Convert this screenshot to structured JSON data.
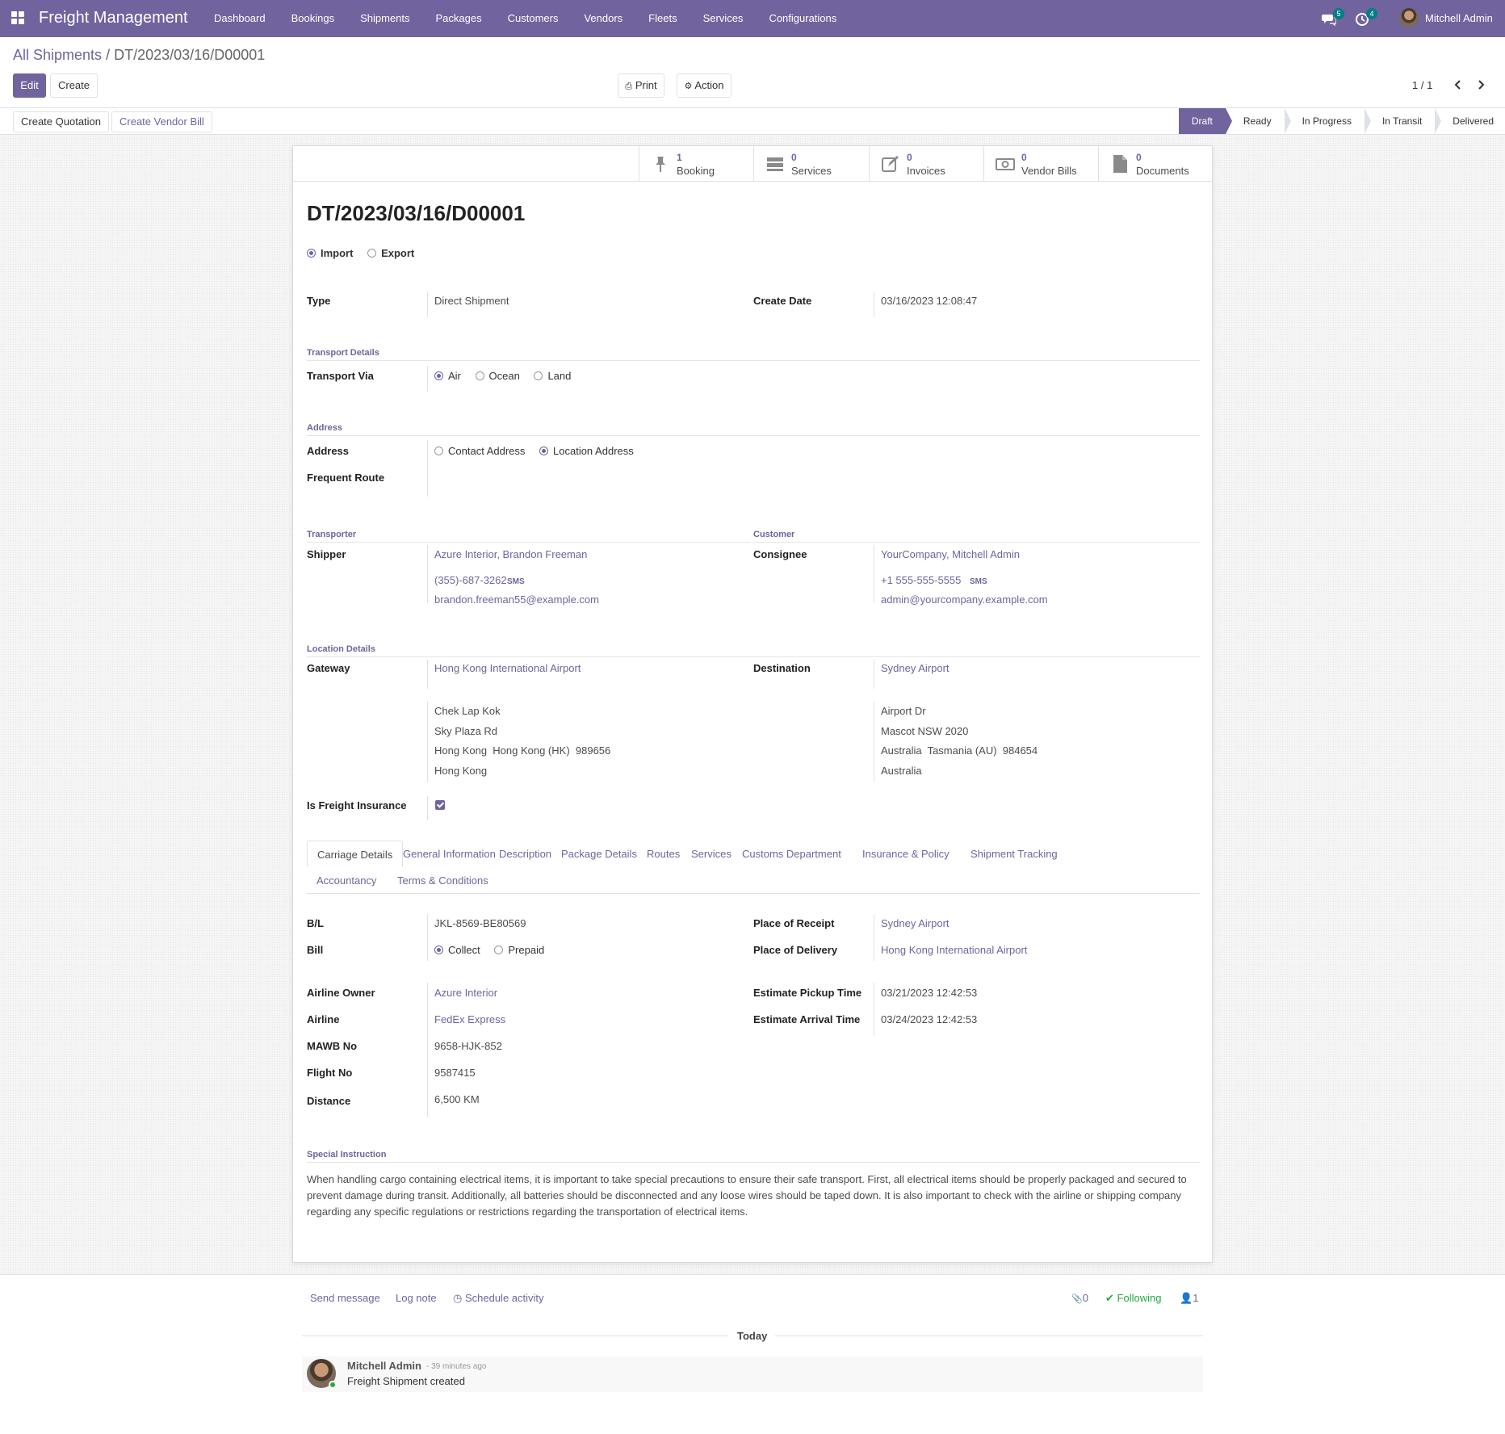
{
  "app": {
    "brand": "Freight Management",
    "user": "Mitchell Admin"
  },
  "navbar": {
    "menu": [
      "Dashboard",
      "Bookings",
      "Shipments",
      "Packages",
      "Customers",
      "Vendors",
      "Fleets",
      "Services",
      "Configurations"
    ],
    "messages_badge": "5",
    "activities_badge": "4",
    "icons": [
      "apps-grid-icon",
      "chat-icon",
      "activity-clock-icon"
    ]
  },
  "breadcrumb": {
    "parent": "All Shipments",
    "separator": "/",
    "current": "DT/2023/03/16/D00001"
  },
  "controls": {
    "edit": "Edit",
    "create": "Create",
    "print": "Print",
    "action": "Action",
    "pager": "1 / 1"
  },
  "statusbar": {
    "create_quotation": "Create Quotation",
    "create_vendor_bill": "Create Vendor Bill",
    "stages": [
      "Draft",
      "Ready",
      "In Progress",
      "In Transit",
      "Delivered"
    ],
    "active_stage": "Draft"
  },
  "smart_buttons": [
    {
      "count": "1",
      "label": "Booking",
      "icon": "pin-icon"
    },
    {
      "count": "0",
      "label": "Services",
      "icon": "server-icon"
    },
    {
      "count": "0",
      "label": "Invoices",
      "icon": "edit-icon"
    },
    {
      "count": "0",
      "label": "Vendor Bills",
      "icon": "money-icon"
    },
    {
      "count": "0",
      "label": "Documents",
      "icon": "file-icon"
    }
  ],
  "record": {
    "name": "DT/2023/03/16/D00001",
    "direction_options": [
      "Import",
      "Export"
    ],
    "direction": "Import",
    "type_label": "Type",
    "type": "Direct Shipment",
    "create_date_label": "Create Date",
    "create_date": "03/16/2023 12:08:47",
    "transport_section": "Transport Details",
    "transport_label": "Transport Via",
    "transport_options": [
      "Air",
      "Ocean",
      "Land"
    ],
    "transport": "Air",
    "address_section": "Address",
    "address_label": "Address",
    "address_options": [
      "Contact Address",
      "Location Address"
    ],
    "address": "Location Address",
    "frequent_route_label": "Frequent Route",
    "transporter_section": "Transporter",
    "customer_section": "Customer",
    "shipper_label": "Shipper",
    "shipper": {
      "name": "Azure Interior, Brandon Freeman",
      "phone": "(355)-687-3262",
      "sms": "SMS",
      "email": "brandon.freeman55@example.com"
    },
    "consignee_label": "Consignee",
    "consignee": {
      "name": "YourCompany, Mitchell Admin",
      "phone": "+1 555-555-5555",
      "sms": "SMS",
      "email": "admin@yourcompany.example.com"
    },
    "location_section": "Location Details",
    "gateway_label": "Gateway",
    "gateway": {
      "name": "Hong Kong International Airport",
      "lines": [
        "Chek Lap Kok",
        "Sky Plaza Rd",
        "Hong Kong  Hong Kong (HK)  989656",
        "Hong Kong"
      ]
    },
    "destination_label": "Destination",
    "destination": {
      "name": "Sydney Airport",
      "lines": [
        "Airport Dr",
        "Mascot NSW 2020",
        "Australia  Tasmania (AU)  984654",
        "Australia"
      ]
    },
    "insurance_label": "Is Freight Insurance",
    "insurance": true
  },
  "tabs": [
    "Carriage Details",
    "General Information",
    "Description",
    "Package Details",
    "Routes",
    "Services",
    "Customs Department",
    "Insurance & Policy",
    "Shipment Tracking",
    "Accountancy",
    "Terms & Conditions"
  ],
  "carriage": {
    "bl_label": "B/L",
    "bl": "JKL-8569-BE80569",
    "bill_label": "Bill",
    "bill_options": [
      "Collect",
      "Prepaid"
    ],
    "bill": "Collect",
    "airline_owner_label": "Airline Owner",
    "airline_owner": "Azure Interior",
    "airline_label": "Airline",
    "airline": "FedEx Express",
    "mawb_label": "MAWB No",
    "mawb": "9658-HJK-852",
    "flight_label": "Flight No",
    "flight": "9587415",
    "distance_label": "Distance",
    "distance": "6,500 KM",
    "receipt_label": "Place of Receipt",
    "receipt": "Sydney Airport",
    "delivery_label": "Place of Delivery",
    "delivery": "Hong Kong International Airport",
    "pickup_label": "Estimate Pickup Time",
    "pickup": "03/21/2023 12:42:53",
    "arrival_label": "Estimate Arrival Time",
    "arrival": "03/24/2023 12:42:53",
    "special_section": "Special Instruction",
    "special": "When handling cargo containing electrical items, it is important to take special precautions to ensure their safe transport. First, all electrical items should be properly packaged and secured to prevent damage during transit. Additionally, all batteries should be disconnected and any loose wires should be taped down. It is also important to check with the airline or shipping company regarding any specific regulations or restrictions regarding the transportation of electrical items."
  },
  "chatter": {
    "send_message": "Send message",
    "log_note": "Log note",
    "schedule": "Schedule activity",
    "attachments": "0",
    "following": "Following",
    "followers": "1",
    "today": "Today",
    "author": "Mitchell Admin",
    "time": "- 39 minutes ago",
    "body": "Freight Shipment created"
  },
  "colors": {
    "brand": "#71639e",
    "badge": "#017e84",
    "following": "#28a745"
  }
}
